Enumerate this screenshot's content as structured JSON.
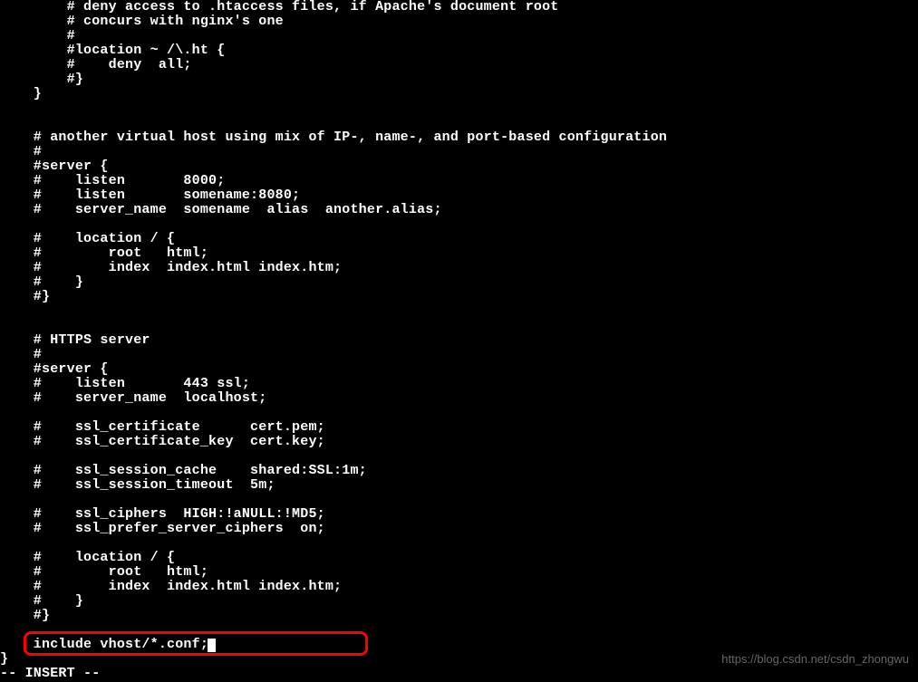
{
  "lines": [
    "        # deny access to .htaccess files, if Apache's document root",
    "        # concurs with nginx's one",
    "        #",
    "        #location ~ /\\.ht {",
    "        #    deny  all;",
    "        #}",
    "    }",
    "",
    "",
    "    # another virtual host using mix of IP-, name-, and port-based configuration",
    "    #",
    "    #server {",
    "    #    listen       8000;",
    "    #    listen       somename:8080;",
    "    #    server_name  somename  alias  another.alias;",
    "",
    "    #    location / {",
    "    #        root   html;",
    "    #        index  index.html index.htm;",
    "    #    }",
    "    #}",
    "",
    "",
    "    # HTTPS server",
    "    #",
    "    #server {",
    "    #    listen       443 ssl;",
    "    #    server_name  localhost;",
    "",
    "    #    ssl_certificate      cert.pem;",
    "    #    ssl_certificate_key  cert.key;",
    "",
    "    #    ssl_session_cache    shared:SSL:1m;",
    "    #    ssl_session_timeout  5m;",
    "",
    "    #    ssl_ciphers  HIGH:!aNULL:!MD5;",
    "    #    ssl_prefer_server_ciphers  on;",
    "",
    "    #    location / {",
    "    #        root   html;",
    "    #        index  index.html index.htm;",
    "    #    }",
    "    #}",
    "",
    "    include vhost/*.conf;",
    "}",
    "-- INSERT --"
  ],
  "cursor_line_index": 44,
  "watermark": "https://blog.csdn.net/csdn_zhongwu"
}
